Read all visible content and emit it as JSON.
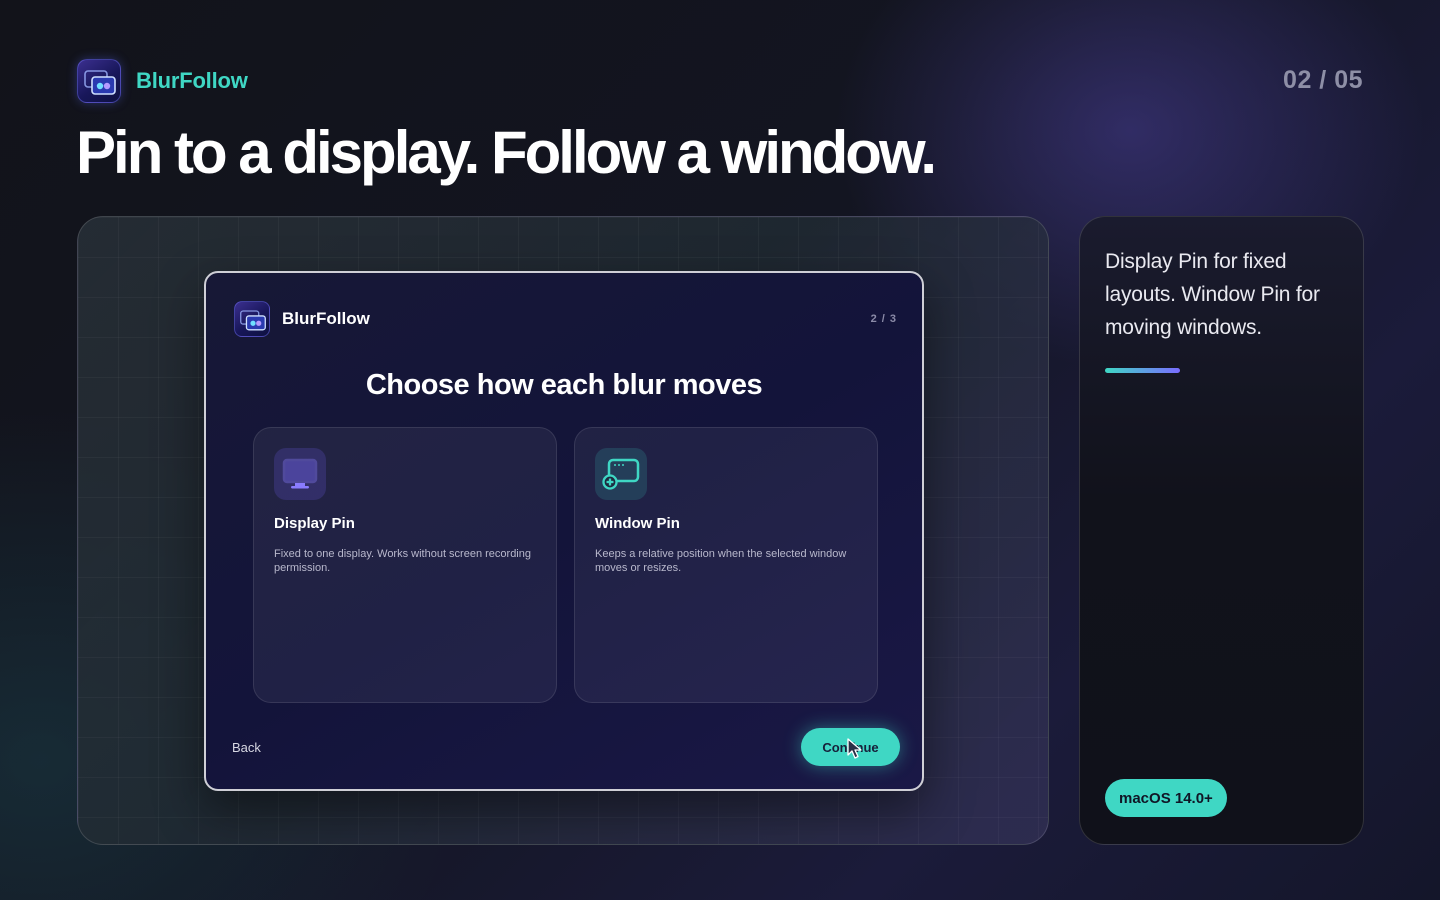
{
  "header": {
    "app_name": "BlurFollow",
    "page_counter": "02 / 05",
    "headline": "Pin to a display. Follow a window."
  },
  "onboarding": {
    "app_name": "BlurFollow",
    "step": "2 / 3",
    "title": "Choose how each blur moves",
    "options": [
      {
        "icon": "monitor-icon",
        "title": "Display Pin",
        "description": "Fixed to one display. Works without screen recording permission."
      },
      {
        "icon": "window-add-icon",
        "title": "Window Pin",
        "description": "Keeps a relative position when the selected window moves or resizes."
      }
    ],
    "back_label": "Back",
    "continue_label": "Continue"
  },
  "side_panel": {
    "text": "Display Pin for fixed layouts. Window Pin for moving windows.",
    "badge": "macOS 14.0+"
  },
  "colors": {
    "accent_teal": "#3fd7c4",
    "accent_purple": "#7a6cff",
    "counter_gray": "#8e8fa6"
  }
}
